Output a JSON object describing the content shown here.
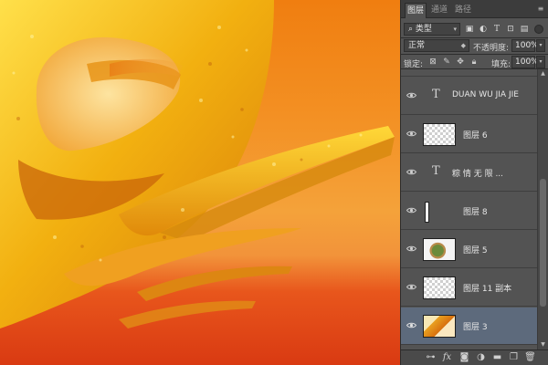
{
  "panel": {
    "tabs": [
      {
        "label": "图层",
        "active": true
      },
      {
        "label": "通道",
        "active": false
      },
      {
        "label": "路径",
        "active": false
      }
    ],
    "filter": {
      "kind_label": "类型"
    },
    "blend": {
      "mode": "正常",
      "opacity_label": "不透明度:",
      "opacity_value": "100%"
    },
    "lock": {
      "label": "锁定:",
      "fill_label": "填充:",
      "fill_value": "100%"
    },
    "layers": [
      {
        "kind": "text",
        "name": "DUAN WU JIA JIE",
        "selected": false
      },
      {
        "kind": "pixel",
        "thumb": "checker",
        "name": "图层 6",
        "selected": false
      },
      {
        "kind": "text",
        "name": "粽 情 无 限 ...",
        "selected": false
      },
      {
        "kind": "pixel",
        "thumb": "line",
        "name": "图层 8",
        "selected": false
      },
      {
        "kind": "pixel",
        "thumb": "food",
        "name": "图层 5",
        "selected": false
      },
      {
        "kind": "pixel",
        "thumb": "checker",
        "name": "图层 11 副本",
        "selected": false
      },
      {
        "kind": "pixel",
        "thumb": "gold",
        "name": "图层 3",
        "selected": true
      }
    ],
    "bottom_icons": [
      "link-icon",
      "fx-icon",
      "mask-icon",
      "adjustment-icon",
      "group-icon",
      "new-layer-icon",
      "trash-icon"
    ],
    "colors": {
      "selected_row": "#5d6a7c",
      "panel_bg": "#535353"
    }
  },
  "canvas": {
    "colors": {
      "bg_top": "#f07e10",
      "bg_bottom": "#d93a12",
      "gold": "#f2b816"
    }
  }
}
